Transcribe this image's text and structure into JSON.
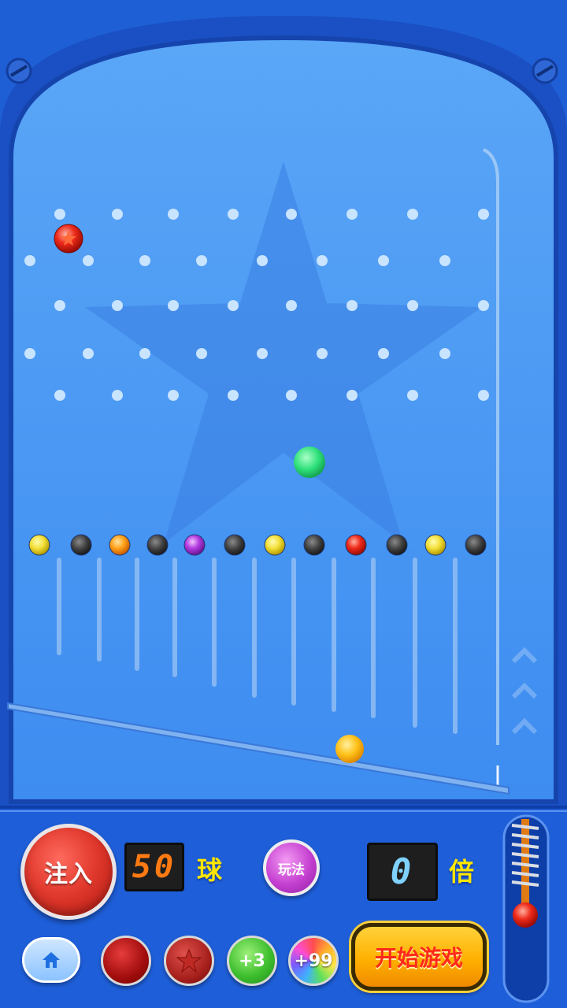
{
  "colors": {
    "frame_blue": "#1f5fd6",
    "board_blue": "#3f8ff0",
    "peg": "#c9e4ff",
    "counter_orange": "#ff7a12",
    "counter_blue": "#7fd2ff",
    "label_yellow": "#ffe600"
  },
  "game": {
    "ball_count": "50",
    "ball_unit": "球",
    "multiplier": "0",
    "multiplier_unit": "倍",
    "slot_markers": [
      "yellow",
      "gray",
      "orange",
      "gray",
      "purple",
      "gray",
      "yellow",
      "gray",
      "red",
      "gray",
      "yellow",
      "gray"
    ],
    "active_balls": [
      "red-star-ball",
      "green-ball",
      "yellow-ball"
    ]
  },
  "controls": {
    "inject_label": "注入",
    "rules_label": "玩法",
    "start_label": "开始游戏",
    "home_icon": "home-icon",
    "powerups": [
      {
        "name": "red-ball",
        "label": ""
      },
      {
        "name": "star-ball",
        "label": ""
      },
      {
        "name": "plus-3",
        "label": "+3"
      },
      {
        "name": "plus-99",
        "label": "+99"
      }
    ]
  }
}
